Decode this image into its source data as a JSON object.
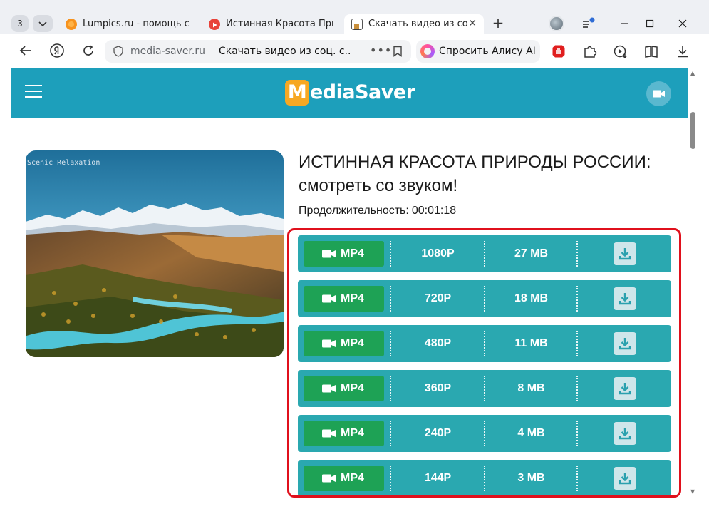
{
  "browser": {
    "tab_count": "3",
    "tabs": [
      {
        "title": "Lumpics.ru - помощь с ком"
      },
      {
        "title": "Истинная Красота Приро"
      },
      {
        "title": "Скачать видео из соц."
      }
    ],
    "address": {
      "domain": "media-saver.ru",
      "page_title": "Скачать видео из соц. с...",
      "menu_dots": "•••"
    },
    "alice_label": "Спросить Алису AI"
  },
  "site": {
    "logo_initial": "M",
    "logo_rest": "ediaSaver"
  },
  "video": {
    "thumbnail_caption": "Scenic Relaxation",
    "title_line1": "ИСТИННАЯ КРАСОТА ПРИРОДЫ РОССИИ:",
    "title_line2": "смотреть со звуком!",
    "duration_label": "Продолжительность:",
    "duration_value": "00:01:18"
  },
  "downloads": [
    {
      "format": "MP4",
      "quality": "1080P",
      "size": "27 MB"
    },
    {
      "format": "MP4",
      "quality": "720P",
      "size": "18 MB"
    },
    {
      "format": "MP4",
      "quality": "480P",
      "size": "11 MB"
    },
    {
      "format": "MP4",
      "quality": "360P",
      "size": "8 MB"
    },
    {
      "format": "MP4",
      "quality": "240P",
      "size": "4 MB"
    },
    {
      "format": "MP4",
      "quality": "144P",
      "size": "3 MB"
    }
  ],
  "icons": {
    "back": "arrow-left-icon",
    "yandex": "yandex-logo-icon",
    "reload": "reload-icon",
    "shield": "shield-icon",
    "bookmark": "bookmark-icon",
    "camera": "video-camera-icon",
    "download": "download-icon",
    "menu": "hamburger-menu-icon"
  },
  "colors": {
    "header": "#1d9fbb",
    "row": "#2aa8b0",
    "format_button": "#1ea255",
    "logo_accent": "#f7a823",
    "highlight": "#e0101c"
  }
}
